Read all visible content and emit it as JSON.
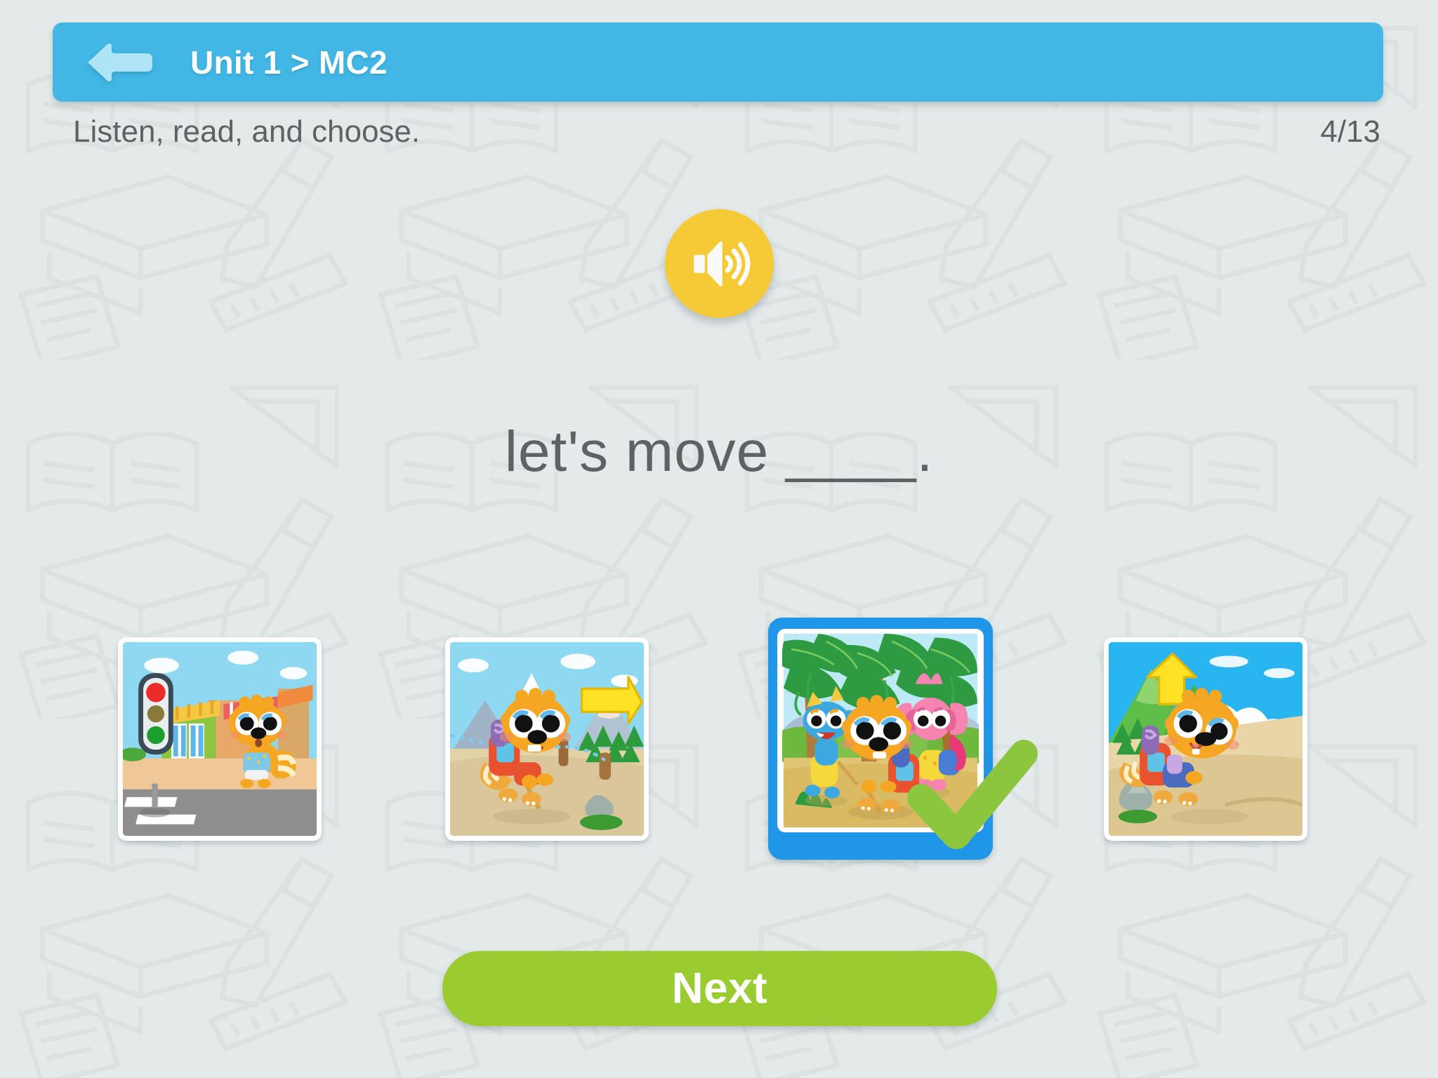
{
  "header": {
    "title": "Unit 1 > MC2",
    "back_icon": "back-arrow-icon",
    "bar_color": "#42B6E4",
    "arrow_color": "#AEE4F5"
  },
  "instruction": {
    "text": "Listen, read, and choose.",
    "counter": "4/13"
  },
  "audio": {
    "icon": "speaker-icon",
    "button_color": "#F6C937",
    "icon_color": "#FFFFFF"
  },
  "question": {
    "prompt": "let's move ____.",
    "text_color": "#5D6265"
  },
  "options": [
    {
      "index": 1,
      "name": "option-traffic-light",
      "description": "Orange raccoon standing at a red traffic light by a crosswalk with shops",
      "selected": false
    },
    {
      "index": 2,
      "name": "option-hiking",
      "description": "Orange raccoon hiking with red backpack and walking stick near mountains, yellow arrow",
      "selected": false
    },
    {
      "index": 3,
      "name": "option-jungle-group",
      "description": "Blue dragon, orange raccoon and pink elephant walking together in a jungle with palm trees",
      "selected": true
    },
    {
      "index": 4,
      "name": "option-rock-path",
      "description": "Orange raccoon with backpack and blue pants beside a rock, yellow arrow pointing up",
      "selected": false
    }
  ],
  "selection": {
    "frame_color": "#1F96E8",
    "check_icon": "check-mark-icon",
    "check_color": "#8CC63F"
  },
  "footer": {
    "next_label": "Next",
    "next_color": "#9ACB30"
  },
  "background": {
    "color": "#E4E9EA",
    "doodle_color": "#DCE3E3"
  }
}
